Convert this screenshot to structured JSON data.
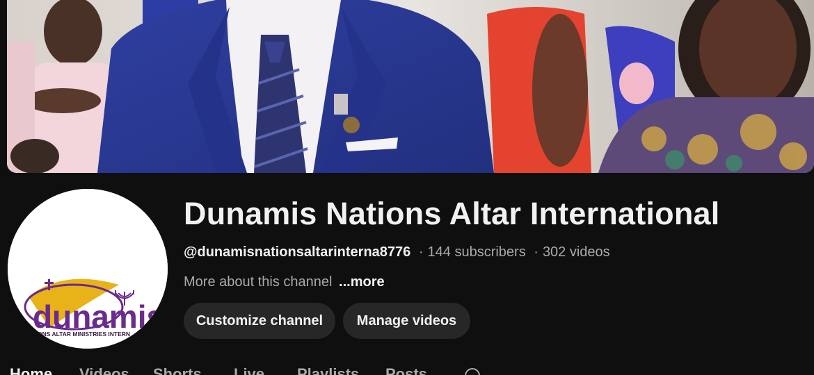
{
  "channel": {
    "name": "Dunamis Nations Altar International",
    "handle": "@dunamisnationsaltarinterna8776",
    "separator": "·",
    "subscribers": "144 subscribers",
    "videos": "302 videos",
    "about_text": "More about this channel",
    "more_label": "...more"
  },
  "avatar": {
    "logo_word": "dunamis",
    "logo_subtitle": "ATIONS ALTAR MINISTRIES INTERN"
  },
  "buttons": {
    "customize": "Customize channel",
    "manage": "Manage videos"
  },
  "tabs": [
    "Home",
    "Videos",
    "Shorts",
    "Live",
    "Playlists",
    "Posts"
  ],
  "icons": {
    "tab_search": "search-icon"
  },
  "colors": {
    "background": "#0f0f0f",
    "button_bg": "#272727",
    "text_primary": "#f1f1f1",
    "text_secondary": "#aaaaaa",
    "logo_purple": "#6a2a8e",
    "logo_gold": "#e8b318"
  }
}
